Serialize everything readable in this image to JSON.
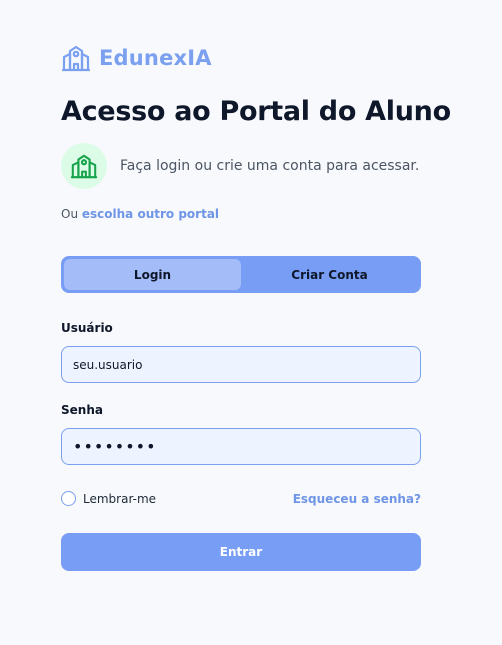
{
  "brand": {
    "name": "EdunexIA",
    "icon": "school-building-icon"
  },
  "page": {
    "title": "Acesso ao Portal do Aluno",
    "intro_icon": "school-building-icon",
    "intro_text": "Faça login ou crie uma conta para acessar.",
    "alt_prefix": "Ou",
    "alt_link": "escolha outro portal"
  },
  "tabs": [
    {
      "label": "Login",
      "active": true
    },
    {
      "label": "Criar Conta",
      "active": false
    }
  ],
  "form": {
    "username_label": "Usuário",
    "username_value": "seu.usuario",
    "password_label": "Senha",
    "password_value": "••••••••",
    "remember_label": "Lembrar-me",
    "forgot_label": "Esqueceu a senha?",
    "submit_label": "Entrar"
  },
  "colors": {
    "accent": "#7ba0ef",
    "tab_bar": "#779df5",
    "active_tab": "#a4bcf8",
    "intro_badge_bg": "#dcfce7",
    "intro_icon": "#16a34a",
    "input_bg": "#eef4ff",
    "page_bg": "#f7f9fc"
  }
}
